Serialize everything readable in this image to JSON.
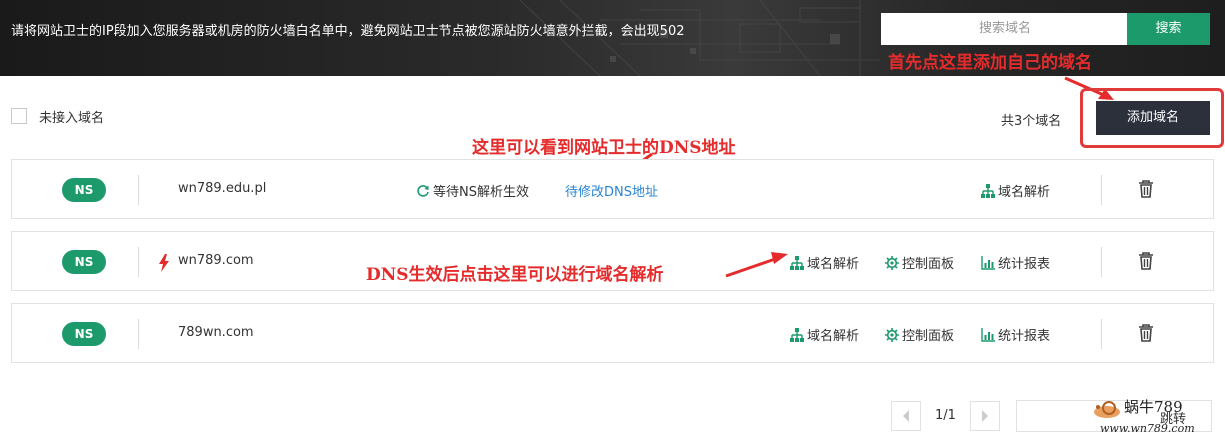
{
  "banner": {
    "notice": "请将网站卫士的IP段加入您服务器或机房的防火墙白名单中，避免网站卫士节点被您源站防火墙意外拦截，会出现502",
    "search_placeholder": "搜索域名",
    "search_button": "搜索"
  },
  "annotations": {
    "add_domain": "首先点这里添加自己的域名",
    "dns_address": "这里可以看到网站卫士的DNS地址",
    "after_dns": "DNS生效后点击这里可以进行域名解析"
  },
  "toolbar": {
    "unconnected_label": "未接入域名",
    "count_text": "共3个域名",
    "add_button": "添加域名"
  },
  "rows": [
    {
      "badge": "NS",
      "domain": "wn789.edu.pl",
      "status": "等待NS解析生效",
      "modify_dns": "待修改DNS地址",
      "dns_resolve": "域名解析"
    },
    {
      "badge": "NS",
      "domain": "wn789.com",
      "dns_resolve": "域名解析",
      "control_panel": "控制面板",
      "stats_report": "统计报表"
    },
    {
      "badge": "NS",
      "domain": "789wn.com",
      "dns_resolve": "域名解析",
      "control_panel": "控制面板",
      "stats_report": "统计报表"
    }
  ],
  "pagination": {
    "page_text": "1/1",
    "jump_label": "跳转"
  },
  "watermark": {
    "name": "蜗牛789",
    "site": "www.wn789.com"
  },
  "colors": {
    "brand_green": "#1d9a6c",
    "annotation_red": "#e52b2b",
    "dark_button": "#2b303b",
    "link_blue": "#2a84d2"
  }
}
